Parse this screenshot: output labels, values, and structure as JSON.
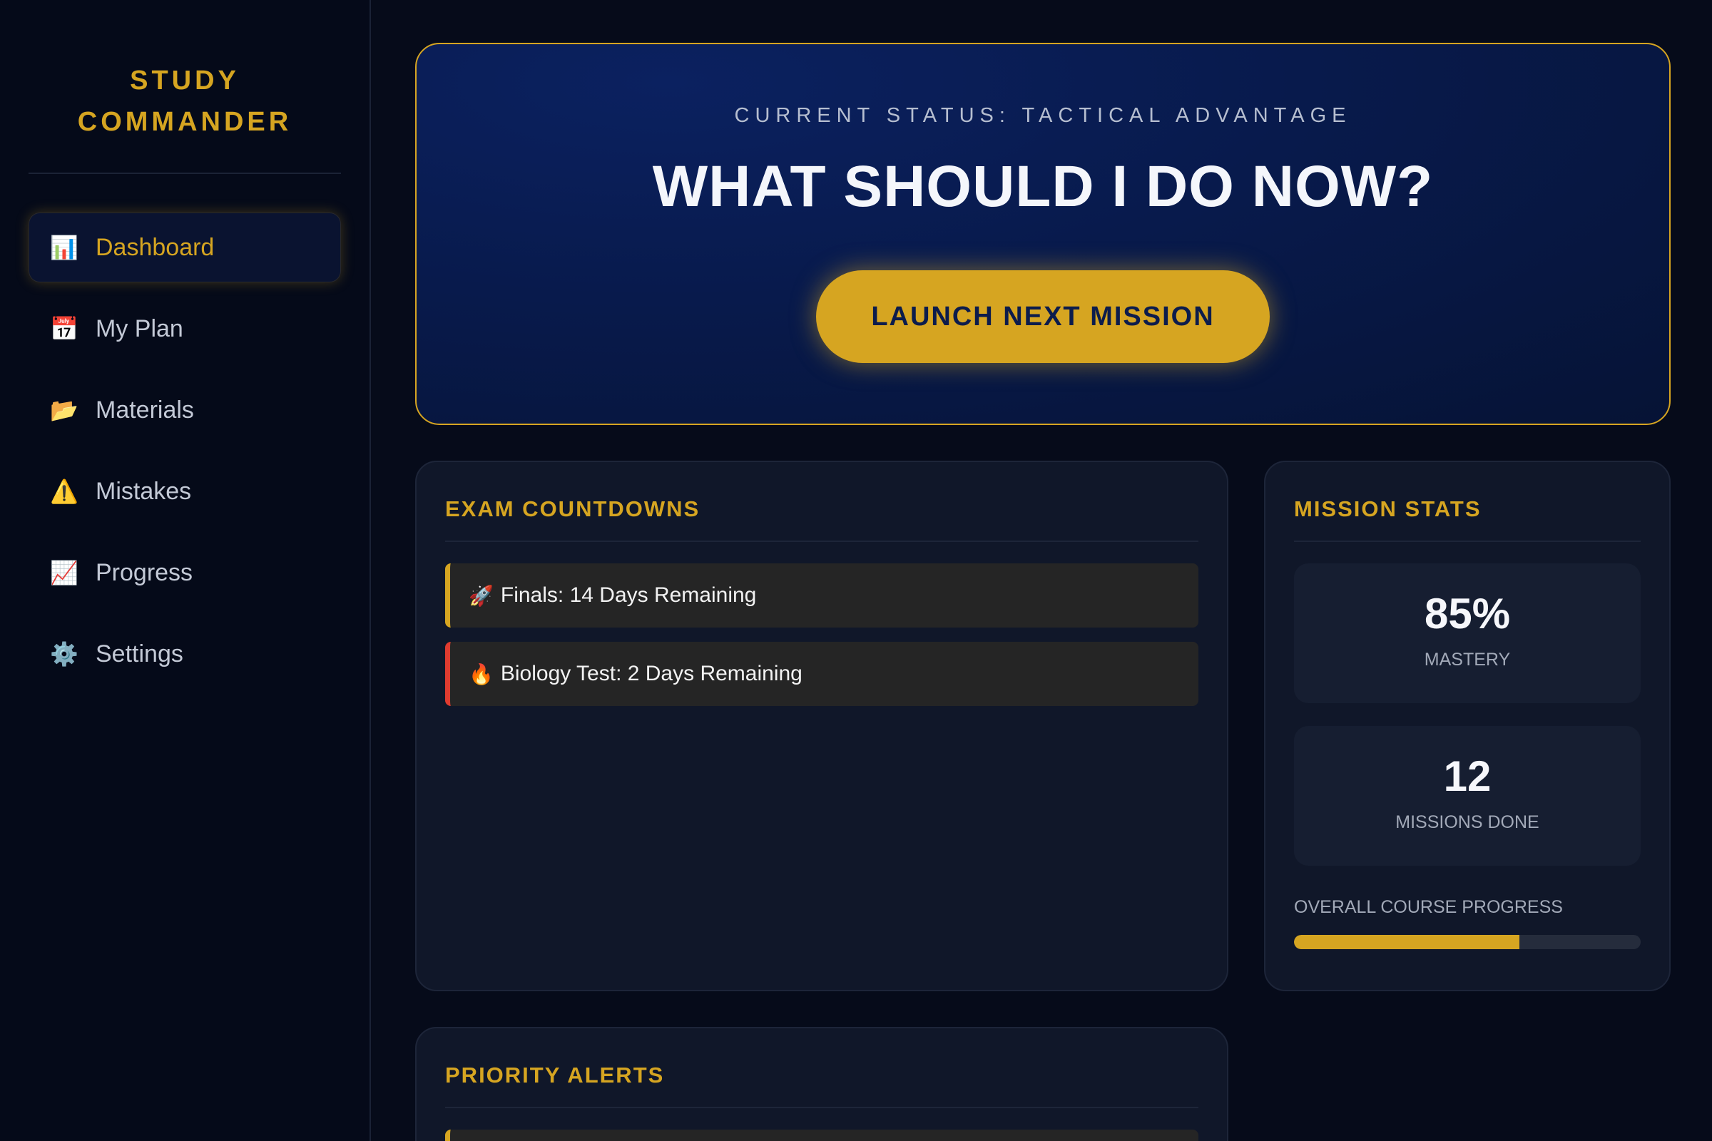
{
  "sidebar": {
    "brand_line1": "STUDY",
    "brand_line2": "COMMANDER",
    "items": [
      {
        "label": "Dashboard",
        "icon": "bar-chart-icon",
        "glyph": "📊",
        "active": true
      },
      {
        "label": "My Plan",
        "icon": "calendar-icon",
        "glyph": "📅",
        "active": false
      },
      {
        "label": "Materials",
        "icon": "folder-icon",
        "glyph": "📂",
        "active": false
      },
      {
        "label": "Mistakes",
        "icon": "warning-icon",
        "glyph": "⚠️",
        "active": false
      },
      {
        "label": "Progress",
        "icon": "trend-chart-icon",
        "glyph": "📈",
        "active": false
      },
      {
        "label": "Settings",
        "icon": "gear-icon",
        "glyph": "⚙️",
        "active": false
      }
    ]
  },
  "hero": {
    "status": "CURRENT STATUS: TACTICAL ADVANTAGE",
    "title": "WHAT SHOULD I DO NOW?",
    "button_label": "LAUNCH NEXT MISSION"
  },
  "countdowns": {
    "title": "EXAM COUNTDOWNS",
    "items": [
      {
        "icon": "rocket-icon",
        "glyph": "🚀",
        "text": "Finals: 14 Days Remaining",
        "accent": "#d6a521"
      },
      {
        "icon": "fire-icon",
        "glyph": "🔥",
        "text": "Biology Test: 2 Days Remaining",
        "accent": "#e03b2f"
      }
    ]
  },
  "stats": {
    "title": "MISSION STATS",
    "mastery_value": "85%",
    "mastery_label": "MASTERY",
    "missions_value": "12",
    "missions_label": "MISSIONS DONE",
    "progress_label": "OVERALL COURSE PROGRESS",
    "progress_fraction": 0.65
  },
  "alerts": {
    "title": "PRIORITY ALERTS"
  },
  "colors": {
    "accent": "#d6a521",
    "danger": "#e03b2f",
    "background": "#060b1a",
    "hero_navy": "#0b2160"
  }
}
